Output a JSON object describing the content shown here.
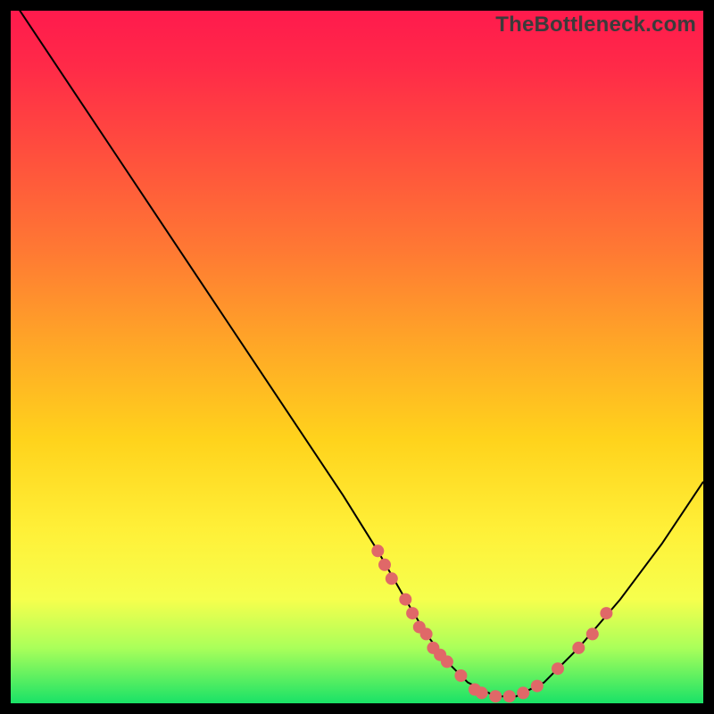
{
  "watermark": "TheBottleneck.com",
  "chart_data": {
    "type": "line",
    "title": "",
    "xlabel": "",
    "ylabel": "",
    "xlim": [
      0,
      100
    ],
    "ylim": [
      0,
      100
    ],
    "series": [
      {
        "name": "bottleneck-curve",
        "x": [
          0,
          10,
          20,
          30,
          40,
          48,
          53,
          57,
          60,
          63,
          66,
          70,
          73,
          77,
          82,
          88,
          94,
          100
        ],
        "y": [
          102,
          87,
          72,
          57,
          42,
          30,
          22,
          15,
          10,
          6,
          3,
          1,
          1,
          3,
          8,
          15,
          23,
          32
        ]
      }
    ],
    "dots": [
      {
        "x": 53,
        "y": 22
      },
      {
        "x": 54,
        "y": 20
      },
      {
        "x": 55,
        "y": 18
      },
      {
        "x": 57,
        "y": 15
      },
      {
        "x": 58,
        "y": 13
      },
      {
        "x": 59,
        "y": 11
      },
      {
        "x": 60,
        "y": 10
      },
      {
        "x": 61,
        "y": 8
      },
      {
        "x": 62,
        "y": 7
      },
      {
        "x": 63,
        "y": 6
      },
      {
        "x": 65,
        "y": 4
      },
      {
        "x": 67,
        "y": 2
      },
      {
        "x": 68,
        "y": 1.5
      },
      {
        "x": 70,
        "y": 1
      },
      {
        "x": 72,
        "y": 1
      },
      {
        "x": 74,
        "y": 1.5
      },
      {
        "x": 76,
        "y": 2.5
      },
      {
        "x": 79,
        "y": 5
      },
      {
        "x": 82,
        "y": 8
      },
      {
        "x": 84,
        "y": 10
      },
      {
        "x": 86,
        "y": 13
      }
    ],
    "dot_color": "#e06868",
    "curve_color": "#000000"
  }
}
